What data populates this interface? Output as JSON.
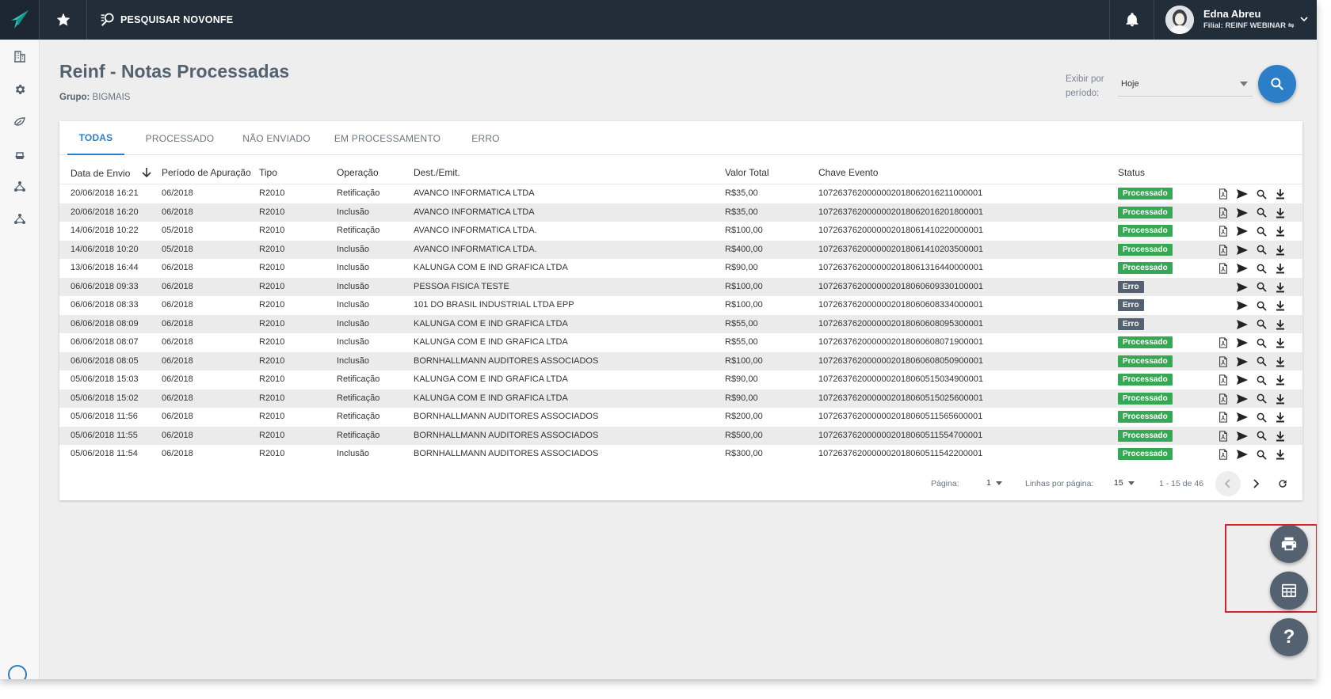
{
  "topbar": {
    "search_label": "PESQUISAR NOVONFE",
    "user_name": "Edna Abreu",
    "user_filial": "Filial: REINF WEBINAR"
  },
  "page": {
    "title": "Reinf - Notas Processadas",
    "group_label": "Grupo:",
    "group_value": "BIGMAIS",
    "period_label": "Exibir por período:",
    "period_value": "Hoje"
  },
  "tabs": [
    "TODAS",
    "PROCESSADO",
    "NÃO ENVIADO",
    "EM PROCESSAMENTO",
    "ERRO"
  ],
  "active_tab": "TODAS",
  "columns": [
    "Data de Envio",
    "Período de Apuração",
    "Tipo",
    "Operação",
    "Dest./Emit.",
    "Valor Total",
    "Chave Evento",
    "Status"
  ],
  "rows": [
    {
      "data_envio": "20/06/2018 16:21",
      "periodo": "06/2018",
      "tipo": "R2010",
      "operacao": "Retificação",
      "dest": "AVANCO INFORMATICA LTDA",
      "valor": "R$35,00",
      "chave": "1072637620000002018062016211000001",
      "status": "Processado"
    },
    {
      "data_envio": "20/06/2018 16:20",
      "periodo": "06/2018",
      "tipo": "R2010",
      "operacao": "Inclusão",
      "dest": "AVANCO INFORMATICA LTDA",
      "valor": "R$35,00",
      "chave": "1072637620000002018062016201800001",
      "status": "Processado"
    },
    {
      "data_envio": "14/06/2018 10:22",
      "periodo": "05/2018",
      "tipo": "R2010",
      "operacao": "Retificação",
      "dest": "AVANCO INFORMATICA LTDA.",
      "valor": "R$100,00",
      "chave": "1072637620000002018061410220000001",
      "status": "Processado"
    },
    {
      "data_envio": "14/06/2018 10:20",
      "periodo": "05/2018",
      "tipo": "R2010",
      "operacao": "Inclusão",
      "dest": "AVANCO INFORMATICA LTDA.",
      "valor": "R$400,00",
      "chave": "1072637620000002018061410203500001",
      "status": "Processado"
    },
    {
      "data_envio": "13/06/2018 16:44",
      "periodo": "06/2018",
      "tipo": "R2010",
      "operacao": "Inclusão",
      "dest": "KALUNGA COM E IND GRAFICA LTDA",
      "valor": "R$90,00",
      "chave": "1072637620000002018061316440000001",
      "status": "Processado"
    },
    {
      "data_envio": "06/06/2018 09:33",
      "periodo": "06/2018",
      "tipo": "R2010",
      "operacao": "Inclusão",
      "dest": "PESSOA FISICA TESTE",
      "valor": "R$100,00",
      "chave": "1072637620000002018060609330100001",
      "status": "Erro"
    },
    {
      "data_envio": "06/06/2018 08:33",
      "periodo": "06/2018",
      "tipo": "R2010",
      "operacao": "Inclusão",
      "dest": "101 DO BRASIL INDUSTRIAL LTDA EPP",
      "valor": "R$100,00",
      "chave": "1072637620000002018060608334000001",
      "status": "Erro"
    },
    {
      "data_envio": "06/06/2018 08:09",
      "periodo": "06/2018",
      "tipo": "R2010",
      "operacao": "Inclusão",
      "dest": "KALUNGA COM E IND GRAFICA LTDA",
      "valor": "R$55,00",
      "chave": "1072637620000002018060608095300001",
      "status": "Erro"
    },
    {
      "data_envio": "06/06/2018 08:07",
      "periodo": "06/2018",
      "tipo": "R2010",
      "operacao": "Inclusão",
      "dest": "KALUNGA COM E IND GRAFICA LTDA",
      "valor": "R$55,00",
      "chave": "1072637620000002018060608071900001",
      "status": "Processado"
    },
    {
      "data_envio": "06/06/2018 08:05",
      "periodo": "06/2018",
      "tipo": "R2010",
      "operacao": "Inclusão",
      "dest": "BORNHALLMANN AUDITORES ASSOCIADOS",
      "valor": "R$100,00",
      "chave": "1072637620000002018060608050900001",
      "status": "Processado"
    },
    {
      "data_envio": "05/06/2018 15:03",
      "periodo": "06/2018",
      "tipo": "R2010",
      "operacao": "Retificação",
      "dest": "KALUNGA COM E IND GRAFICA LTDA",
      "valor": "R$90,00",
      "chave": "1072637620000002018060515034900001",
      "status": "Processado"
    },
    {
      "data_envio": "05/06/2018 15:02",
      "periodo": "06/2018",
      "tipo": "R2010",
      "operacao": "Retificação",
      "dest": "KALUNGA COM E IND GRAFICA LTDA",
      "valor": "R$90,00",
      "chave": "1072637620000002018060515025600001",
      "status": "Processado"
    },
    {
      "data_envio": "05/06/2018 11:56",
      "periodo": "06/2018",
      "tipo": "R2010",
      "operacao": "Retificação",
      "dest": "BORNHALLMANN AUDITORES ASSOCIADOS",
      "valor": "R$200,00",
      "chave": "1072637620000002018060511565600001",
      "status": "Processado"
    },
    {
      "data_envio": "05/06/2018 11:55",
      "periodo": "06/2018",
      "tipo": "R2010",
      "operacao": "Retificação",
      "dest": "BORNHALLMANN AUDITORES ASSOCIADOS",
      "valor": "R$500,00",
      "chave": "1072637620000002018060511554700001",
      "status": "Processado"
    },
    {
      "data_envio": "05/06/2018 11:54",
      "periodo": "06/2018",
      "tipo": "R2010",
      "operacao": "Inclusão",
      "dest": "BORNHALLMANN AUDITORES ASSOCIADOS",
      "valor": "R$300,00",
      "chave": "1072637620000002018060511542200001",
      "status": "Processado"
    }
  ],
  "footer": {
    "page_label": "Página:",
    "page_value": "1",
    "rows_label": "Linhas por página:",
    "rows_value": "15",
    "range": "1 - 15 de 46"
  },
  "fabs": [
    "print-icon",
    "table-icon",
    "help-icon"
  ],
  "colors": {
    "topbar": "#222d3a",
    "accent": "#2d7ec9",
    "processado": "#35a853",
    "erro": "#546170",
    "highlight": "#d6232a"
  }
}
